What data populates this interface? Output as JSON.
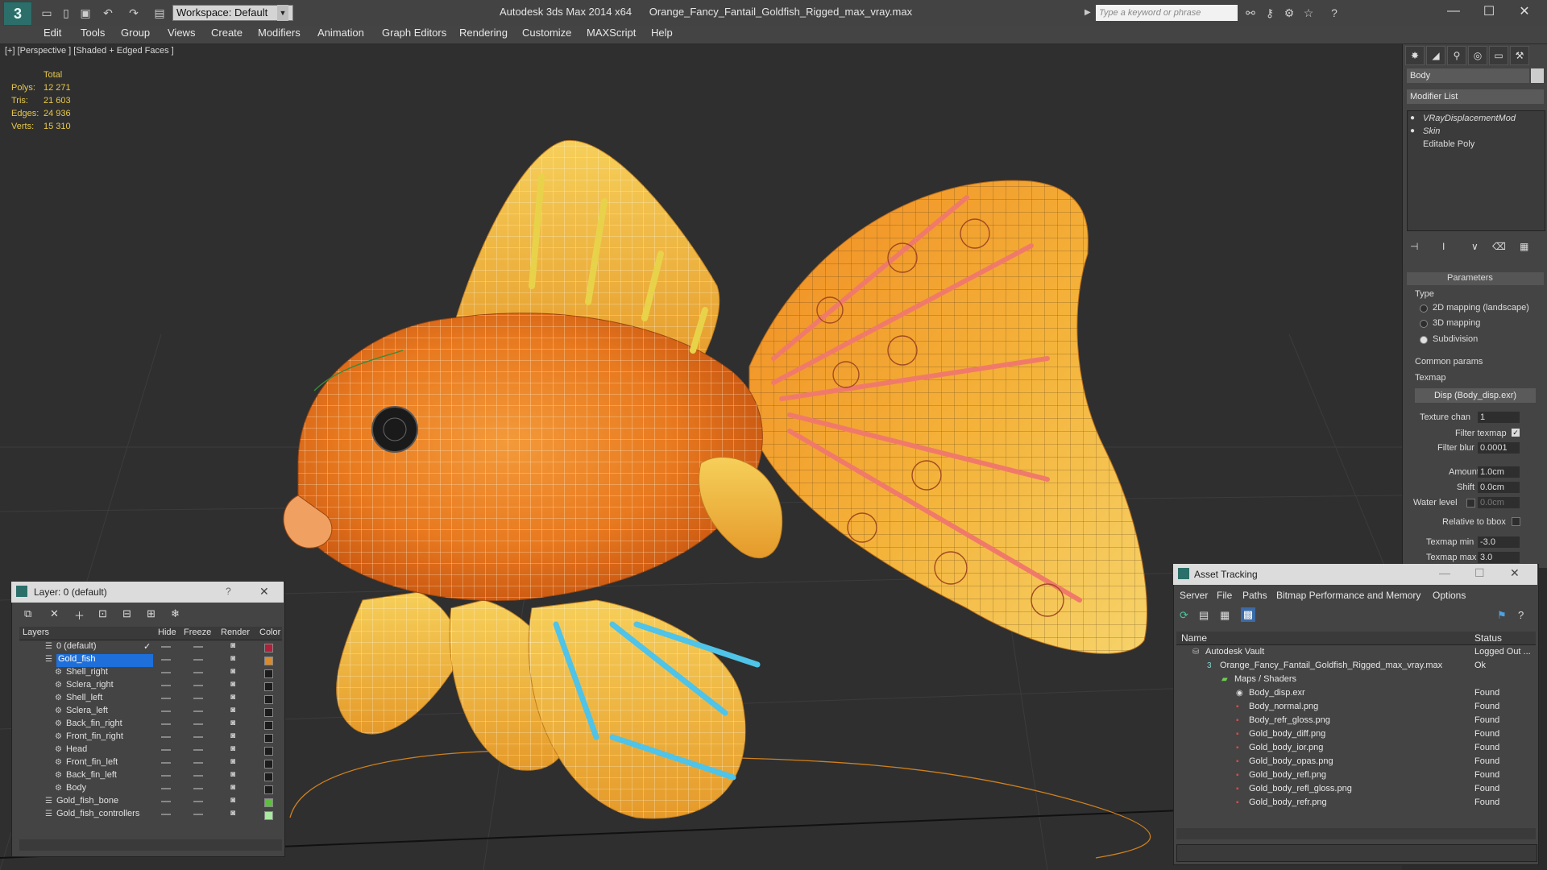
{
  "titlebar": {
    "workspace": "Workspace: Default",
    "app_title": "Autodesk 3ds Max 2014 x64",
    "file_title": "Orange_Fancy_Fantail_Goldfish_Rigged_max_vray.max",
    "search_placeholder": "Type a keyword or phrase"
  },
  "menu": [
    "Edit",
    "Tools",
    "Group",
    "Views",
    "Create",
    "Modifiers",
    "Animation",
    "Graph Editors",
    "Rendering",
    "Customize",
    "MAXScript",
    "Help"
  ],
  "viewport": {
    "label": "[+] [Perspective ] [Shaded + Edged Faces ]",
    "stats_header": "Total",
    "stats": [
      {
        "label": "Polys:",
        "value": "12 271"
      },
      {
        "label": "Tris:",
        "value": "21 603"
      },
      {
        "label": "Edges:",
        "value": "24 936"
      },
      {
        "label": "Verts:",
        "value": "15 310"
      }
    ]
  },
  "command_panel": {
    "object_name": "Body",
    "modifier_list": "Modifier List",
    "stack": [
      "VRayDisplacementMod",
      "Skin",
      "Editable Poly"
    ],
    "rollout_title": "Parameters",
    "type_label": "Type",
    "type_options": [
      {
        "label": "2D mapping (landscape)",
        "selected": false
      },
      {
        "label": "3D mapping",
        "selected": false
      },
      {
        "label": "Subdivision",
        "selected": true
      }
    ],
    "common_params": "Common params",
    "texmap_label": "Texmap",
    "texmap_value": "Disp (Body_disp.exr)",
    "texture_chan_label": "Texture chan",
    "texture_chan_value": "1",
    "filter_texmap_label": "Filter texmap",
    "filter_blur_label": "Filter blur",
    "filter_blur_value": "0.0001",
    "amount_label": "Amount",
    "amount_value": "1.0cm",
    "shift_label": "Shift",
    "shift_value": "0.0cm",
    "water_level_label": "Water level",
    "water_level_value": "0.0cm",
    "relative_bbox_label": "Relative to bbox",
    "texmap_min_label": "Texmap min",
    "texmap_min_value": "-3.0",
    "texmap_max_label": "Texmap max",
    "texmap_max_value": "3.0"
  },
  "layer_dialog": {
    "title": "Layer: 0 (default)",
    "help": "?",
    "columns": [
      "Layers",
      "Hide",
      "Freeze",
      "Render",
      "Color"
    ],
    "rows": [
      {
        "name": "0 (default)",
        "indent": 1,
        "active": true,
        "color": "#b0203a"
      },
      {
        "name": "Gold_fish",
        "indent": 1,
        "selected": true,
        "color": "#d98a2a"
      },
      {
        "name": "Shell_right",
        "indent": 2,
        "color": "#1c1c1c"
      },
      {
        "name": "Sclera_right",
        "indent": 2,
        "color": "#1c1c1c"
      },
      {
        "name": "Shell_left",
        "indent": 2,
        "color": "#1c1c1c"
      },
      {
        "name": "Sclera_left",
        "indent": 2,
        "color": "#1c1c1c"
      },
      {
        "name": "Back_fin_right",
        "indent": 2,
        "color": "#1c1c1c"
      },
      {
        "name": "Front_fin_right",
        "indent": 2,
        "color": "#1c1c1c"
      },
      {
        "name": "Head",
        "indent": 2,
        "color": "#1c1c1c"
      },
      {
        "name": "Front_fin_left",
        "indent": 2,
        "color": "#1c1c1c"
      },
      {
        "name": "Back_fin_left",
        "indent": 2,
        "color": "#1c1c1c"
      },
      {
        "name": "Body",
        "indent": 2,
        "color": "#1c1c1c"
      },
      {
        "name": "Gold_fish_bone",
        "indent": 1,
        "color": "#5cc03c"
      },
      {
        "name": "Gold_fish_controllers",
        "indent": 1,
        "color": "#a8e8a0"
      }
    ]
  },
  "asset_dialog": {
    "title": "Asset Tracking",
    "menu": [
      "Server",
      "File",
      "Paths",
      "Bitmap Performance and Memory",
      "Options"
    ],
    "col_name": "Name",
    "col_status": "Status",
    "rows": [
      {
        "name": "Autodesk Vault",
        "status": "Logged Out ...",
        "indent": 0
      },
      {
        "name": "Orange_Fancy_Fantail_Goldfish_Rigged_max_vray.max",
        "status": "Ok",
        "indent": 1
      },
      {
        "name": "Maps / Shaders",
        "status": "",
        "indent": 2
      },
      {
        "name": "Body_disp.exr",
        "status": "Found",
        "indent": 3
      },
      {
        "name": "Body_normal.png",
        "status": "Found",
        "indent": 3
      },
      {
        "name": "Body_refr_gloss.png",
        "status": "Found",
        "indent": 3
      },
      {
        "name": "Gold_body_diff.png",
        "status": "Found",
        "indent": 3
      },
      {
        "name": "Gold_body_ior.png",
        "status": "Found",
        "indent": 3
      },
      {
        "name": "Gold_body_opas.png",
        "status": "Found",
        "indent": 3
      },
      {
        "name": "Gold_body_refl.png",
        "status": "Found",
        "indent": 3
      },
      {
        "name": "Gold_body_refl_gloss.png",
        "status": "Found",
        "indent": 3
      },
      {
        "name": "Gold_body_refr.png",
        "status": "Found",
        "indent": 3
      }
    ]
  },
  "colors": {
    "accent": "#2c6f6a",
    "stats": "#e8c84a",
    "fish_orange": "#e8791f",
    "fish_yellow": "#f4c24a",
    "bones_red": "#f07a6a",
    "bones_blue": "#4fc3e8"
  }
}
